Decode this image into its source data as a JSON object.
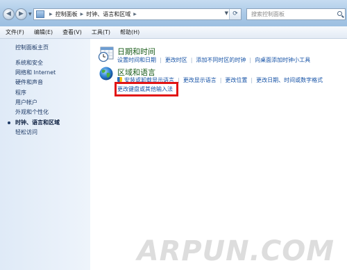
{
  "address": {
    "crumbs": [
      "控制面板",
      "时钟、语言和区域"
    ],
    "search_placeholder": "搜索控制面板"
  },
  "menu": [
    "文件(F)",
    "编辑(E)",
    "查看(V)",
    "工具(T)",
    "帮助(H)"
  ],
  "sidebar": {
    "items": [
      {
        "label": "控制面板主页"
      },
      {
        "label": "系统和安全"
      },
      {
        "label": "网络和 Internet"
      },
      {
        "label": "硬件和声音"
      },
      {
        "label": "程序"
      },
      {
        "label": "用户帐户"
      },
      {
        "label": "外观和个性化"
      },
      {
        "label": "时钟、语言和区域",
        "current": true
      },
      {
        "label": "轻松访问"
      }
    ]
  },
  "main": {
    "datetime": {
      "title": "日期和时间",
      "links": [
        "设置时间和日期",
        "更改时区",
        "添加不同时区的时钟",
        "向桌面添加时钟小工具"
      ]
    },
    "region": {
      "title": "区域和语言",
      "links": [
        "安装或卸载显示语言",
        "更改显示语言",
        "更改位置",
        "更改日期、时间或数字格式"
      ],
      "extra_link": "更改键盘或其他输入法"
    }
  },
  "watermark": "ARPUN.COM",
  "colors": {
    "link": "#1552a6",
    "category_title": "#1a5c1a",
    "highlight": "#e11414",
    "sidebar_bg": "#e6eff9"
  }
}
